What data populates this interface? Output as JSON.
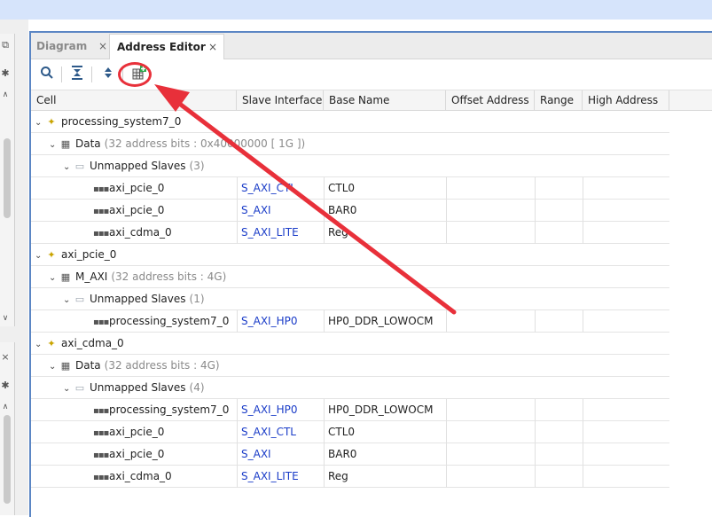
{
  "tabs": [
    {
      "label": "Diagram",
      "close": "×"
    },
    {
      "label": "Address Editor",
      "close": "×"
    }
  ],
  "toolbar": {
    "icons": [
      "search-icon",
      "collapse-all-icon",
      "expand-all-icon",
      "auto-assign-address-icon"
    ]
  },
  "columns": [
    "Cell",
    "Slave Interface",
    "Base Name",
    "Offset Address",
    "Range",
    "High Address"
  ],
  "rows": [
    {
      "level": 0,
      "expand": "⌄",
      "icon": "cpu",
      "name": "processing_system7_0",
      "detail": "",
      "iface": "",
      "base": ""
    },
    {
      "level": 1,
      "expand": "⌄",
      "icon": "grid",
      "name": "Data",
      "detail": "(32 address bits : 0x40000000 [ 1G ])",
      "iface": "",
      "base": ""
    },
    {
      "level": 2,
      "expand": "⌄",
      "icon": "folder",
      "name": "Unmapped Slaves",
      "detail": "(3)",
      "iface": "",
      "base": ""
    },
    {
      "level": 3,
      "expand": "",
      "icon": "port",
      "name": "axi_pcie_0",
      "detail": "",
      "iface": "S_AXI_CTL",
      "base": "CTL0"
    },
    {
      "level": 3,
      "expand": "",
      "icon": "port",
      "name": "axi_pcie_0",
      "detail": "",
      "iface": "S_AXI",
      "base": "BAR0"
    },
    {
      "level": 3,
      "expand": "",
      "icon": "port",
      "name": "axi_cdma_0",
      "detail": "",
      "iface": "S_AXI_LITE",
      "base": "Reg"
    },
    {
      "level": 0,
      "expand": "⌄",
      "icon": "cpu",
      "name": "axi_pcie_0",
      "detail": "",
      "iface": "",
      "base": ""
    },
    {
      "level": 1,
      "expand": "⌄",
      "icon": "grid",
      "name": "M_AXI",
      "detail": "(32 address bits : 4G)",
      "iface": "",
      "base": ""
    },
    {
      "level": 2,
      "expand": "⌄",
      "icon": "folder",
      "name": "Unmapped Slaves",
      "detail": "(1)",
      "iface": "",
      "base": ""
    },
    {
      "level": 3,
      "expand": "",
      "icon": "port",
      "name": "processing_system7_0",
      "detail": "",
      "iface": "S_AXI_HP0",
      "base": "HP0_DDR_LOWOCM"
    },
    {
      "level": 0,
      "expand": "⌄",
      "icon": "cpu",
      "name": "axi_cdma_0",
      "detail": "",
      "iface": "",
      "base": ""
    },
    {
      "level": 1,
      "expand": "⌄",
      "icon": "grid",
      "name": "Data",
      "detail": "(32 address bits : 4G)",
      "iface": "",
      "base": ""
    },
    {
      "level": 2,
      "expand": "⌄",
      "icon": "folder",
      "name": "Unmapped Slaves",
      "detail": "(4)",
      "iface": "",
      "base": ""
    },
    {
      "level": 3,
      "expand": "",
      "icon": "port",
      "name": "processing_system7_0",
      "detail": "",
      "iface": "S_AXI_HP0",
      "base": "HP0_DDR_LOWOCM"
    },
    {
      "level": 3,
      "expand": "",
      "icon": "port",
      "name": "axi_pcie_0",
      "detail": "",
      "iface": "S_AXI_CTL",
      "base": "CTL0"
    },
    {
      "level": 3,
      "expand": "",
      "icon": "port",
      "name": "axi_pcie_0",
      "detail": "",
      "iface": "S_AXI",
      "base": "BAR0"
    },
    {
      "level": 3,
      "expand": "",
      "icon": "port",
      "name": "axi_cdma_0",
      "detail": "",
      "iface": "S_AXI_LITE",
      "base": "Reg"
    }
  ],
  "colors": {
    "accent_border": "#5b86c4",
    "link": "#1a3cc8",
    "annotation": "#e8303a",
    "topbar": "#d6e4fb"
  }
}
